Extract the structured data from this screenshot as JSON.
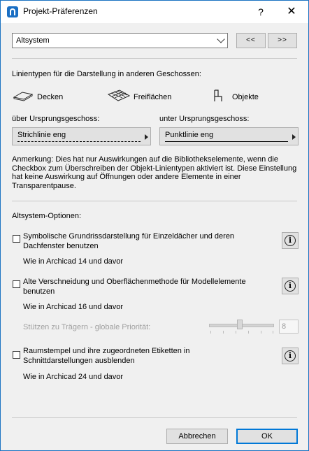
{
  "window": {
    "title": "Projekt-Präferenzen",
    "help": "?",
    "close": "✕"
  },
  "page_selector": {
    "value": "Altsystem",
    "prev_label": "<<",
    "next_label": ">>"
  },
  "linetypes": {
    "heading": "Linientypen für die Darstellung in anderen Geschossen:",
    "categories": [
      {
        "label": "Decken",
        "icon": "slab-icon"
      },
      {
        "label": "Freiflächen",
        "icon": "mesh-icon"
      },
      {
        "label": "Objekte",
        "icon": "chair-icon"
      }
    ],
    "above_label": "über Ursprungsgeschoss:",
    "above_value": "Strichlinie eng",
    "below_label": "unter Ursprungsgeschoss:",
    "below_value": "Punktlinie eng",
    "note": "Anmerkung: Dies hat nur Auswirkungen auf die Bibliothekselemente, wenn die Checkbox zum Überschreiben der Objekt-Linientypen aktiviert ist. Diese Einstellung hat keine Auswirkung auf Öffnungen oder andere Elemente in einer Transparentpause."
  },
  "legacy": {
    "heading": "Altsystem-Optionen:",
    "options": [
      {
        "label": "Symbolische Grundrissdarstellung für Einzeldächer und deren Dachfenster benutzen",
        "sub": "Wie in Archicad 14 und davor",
        "checked": false
      },
      {
        "label": "Alte Verschneidung und Oberflächenmethode für Modellelemente benutzen",
        "sub": "Wie in Archicad 16 und davor",
        "checked": false
      },
      {
        "label": "Raumstempel und ihre zugeordneten Etiketten in Schnittdarstellungen ausblenden",
        "sub": "Wie in Archicad 24 und davor",
        "checked": false
      }
    ],
    "priority_label": "Stützen zu Trägern - globale Priorität:",
    "priority_value": "8",
    "priority_level_fraction": 0.45
  },
  "footer": {
    "cancel": "Abbrechen",
    "ok": "OK"
  },
  "colors": {
    "accent": "#0078d7",
    "frame": "#1b73c2"
  }
}
